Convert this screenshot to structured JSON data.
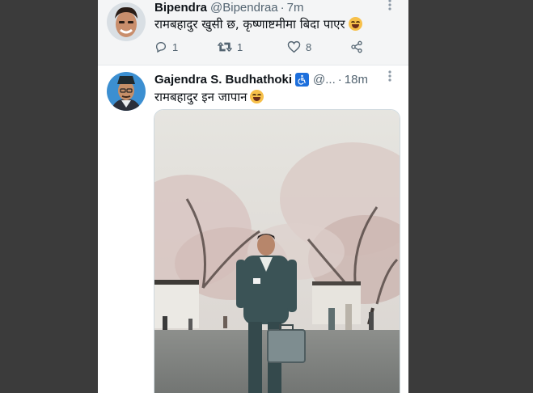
{
  "tweets": [
    {
      "display_name": "Bipendra",
      "handle": "@Bipendraa",
      "separator": "·",
      "time": "7m",
      "text": "रामबहादुर खुसी छ, कृष्णाष्टमीमा बिदा पाएर",
      "emoji_icon": "face-with-tears-of-joy-icon",
      "stats": {
        "replies": "1",
        "retweets": "1",
        "likes": "8"
      }
    },
    {
      "display_name": "Gajendra S. Budhathoki",
      "handle": "@...",
      "separator": "·",
      "time": "18m",
      "text": "रामबहादुर इन जापान",
      "emoji_icon": "face-with-tears-of-joy-icon",
      "badge_icon": "wheelchair-accessibility-icon"
    }
  ],
  "colors": {
    "accent": "#1d9bf0",
    "text_primary": "#0f1419",
    "text_secondary": "#536471",
    "background_outer": "#3b3b3b"
  }
}
